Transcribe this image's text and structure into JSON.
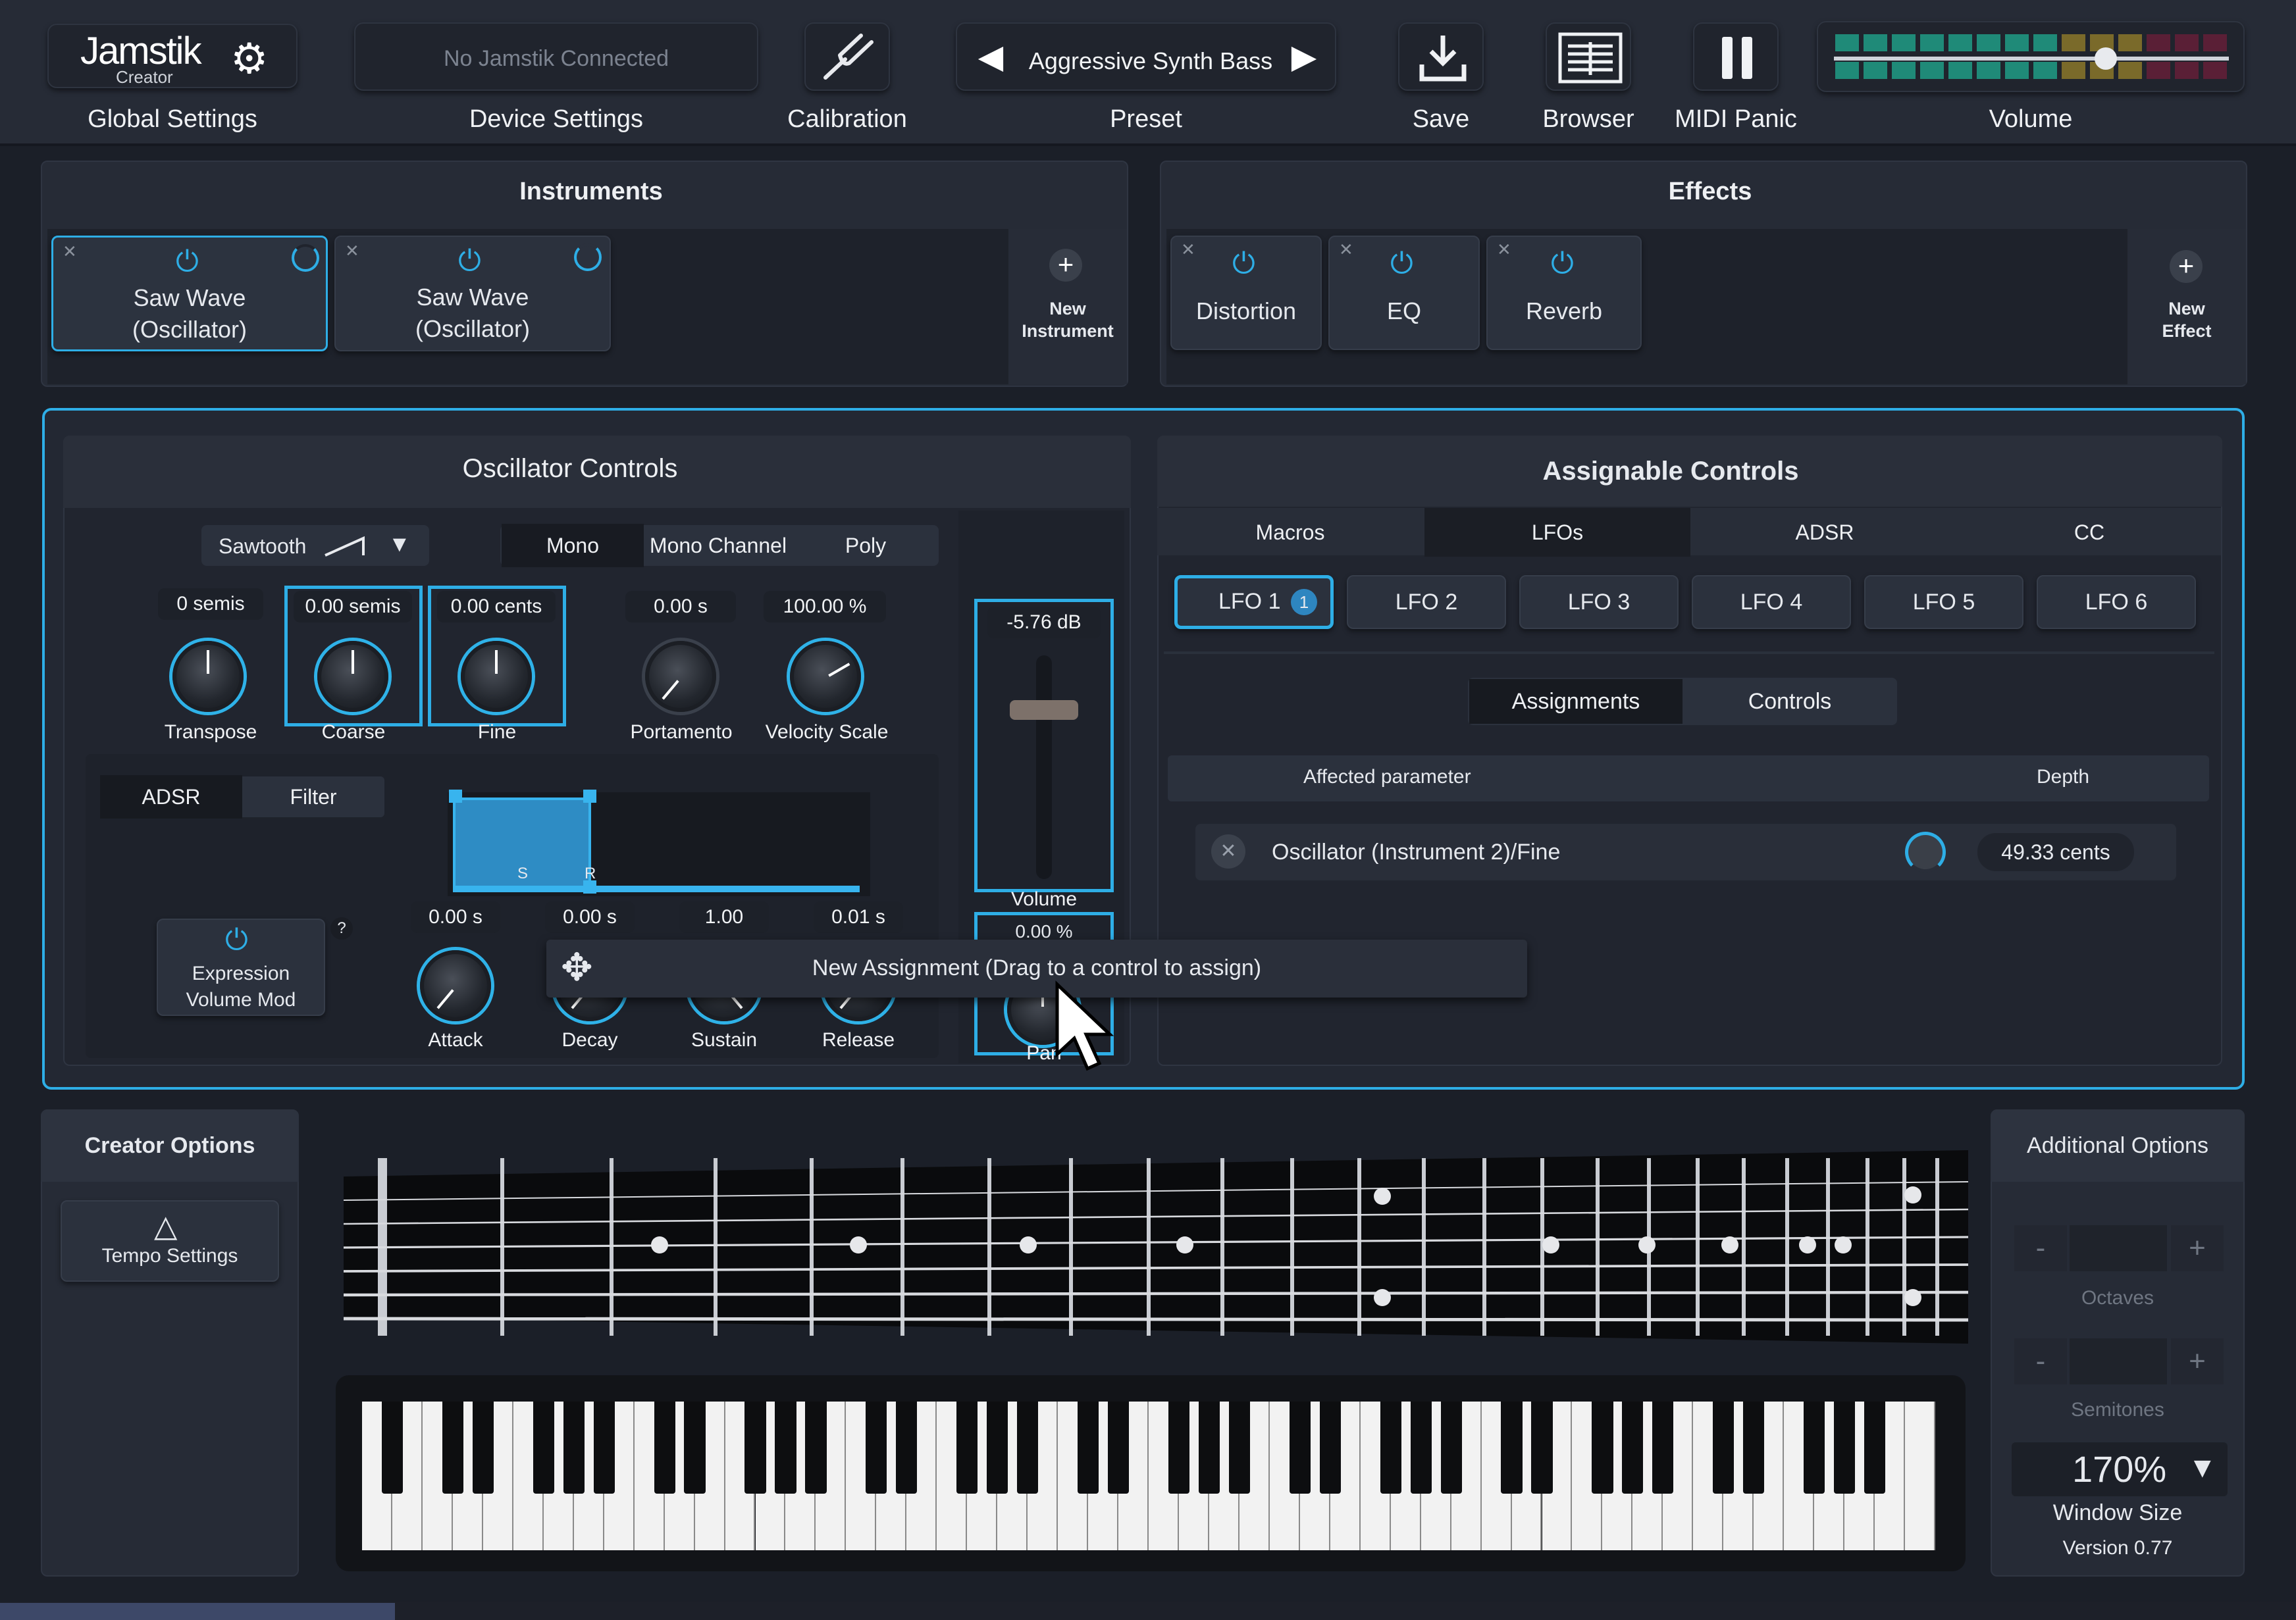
{
  "topbar": {
    "logo": "Jamstik",
    "logo_sub": "Creator",
    "global_settings": "Global Settings",
    "device_status": "No Jamstik Connected",
    "device_settings": "Device Settings",
    "calibration": "Calibration",
    "preset_name": "Aggressive Synth Bass",
    "preset": "Preset",
    "save": "Save",
    "browser": "Browser",
    "midi_panic": "MIDI Panic",
    "volume": "Volume",
    "volume_level": 0.8
  },
  "instruments": {
    "title": "Instruments",
    "items": [
      {
        "label": "Saw Wave\n(Oscillator)",
        "selected": true
      },
      {
        "label": "Saw Wave\n(Oscillator)",
        "selected": false
      }
    ],
    "new_instrument": "New\nInstrument"
  },
  "effects": {
    "title": "Effects",
    "items": [
      {
        "label": "Distortion"
      },
      {
        "label": "EQ"
      },
      {
        "label": "Reverb"
      }
    ],
    "new_effect": "New\nEffect"
  },
  "oscillator": {
    "title": "Oscillator Controls",
    "waveform": "Sawtooth",
    "modes": [
      "Mono",
      "Mono Channel",
      "Poly"
    ],
    "active_mode": "Mono",
    "knobs": [
      {
        "name": "Transpose",
        "value": "0 semis"
      },
      {
        "name": "Coarse",
        "value": "0.00 semis"
      },
      {
        "name": "Fine",
        "value": "0.00 cents"
      },
      {
        "name": "Portamento",
        "value": "0.00 s"
      },
      {
        "name": "Velocity Scale",
        "value": "100.00 %"
      }
    ],
    "env_tabs": [
      "ADSR",
      "Filter"
    ],
    "env_labels": [
      "S",
      "R"
    ],
    "adsr": [
      {
        "name": "Attack",
        "value": "0.00 s"
      },
      {
        "name": "Decay",
        "value": "0.00 s"
      },
      {
        "name": "Sustain",
        "value": "1.00"
      },
      {
        "name": "Release",
        "value": "0.01 s"
      }
    ],
    "expression": "Expression\nVolume Mod",
    "help": "?",
    "volume_value": "-5.76 dB",
    "volume_label": "Volume",
    "pan_value": "0.00 %",
    "pan_label": "Pan"
  },
  "assign": {
    "title": "Assignable Controls",
    "tabs": [
      "Macros",
      "LFOs",
      "ADSR",
      "CC"
    ],
    "active_tab": "LFOs",
    "lfos": [
      "LFO 1",
      "LFO 2",
      "LFO 3",
      "LFO 4",
      "LFO 5",
      "LFO 6"
    ],
    "lfo1_badge": "1",
    "subtabs": [
      "Assignments",
      "Controls"
    ],
    "col_param": "Affected parameter",
    "col_depth": "Depth",
    "row_param": "Oscillator (Instrument 2)/Fine",
    "row_depth": "49.33 cents"
  },
  "tooltip": "New Assignment (Drag to a control to assign)",
  "creator": {
    "title": "Creator Options",
    "tempo": "Tempo Settings"
  },
  "additional": {
    "title": "Additional Options",
    "minus": "-",
    "plus": "+",
    "octaves": "Octaves",
    "semitones": "Semitones",
    "window_size_value": "170%",
    "window_size": "Window Size",
    "version": "Version 0.77"
  }
}
